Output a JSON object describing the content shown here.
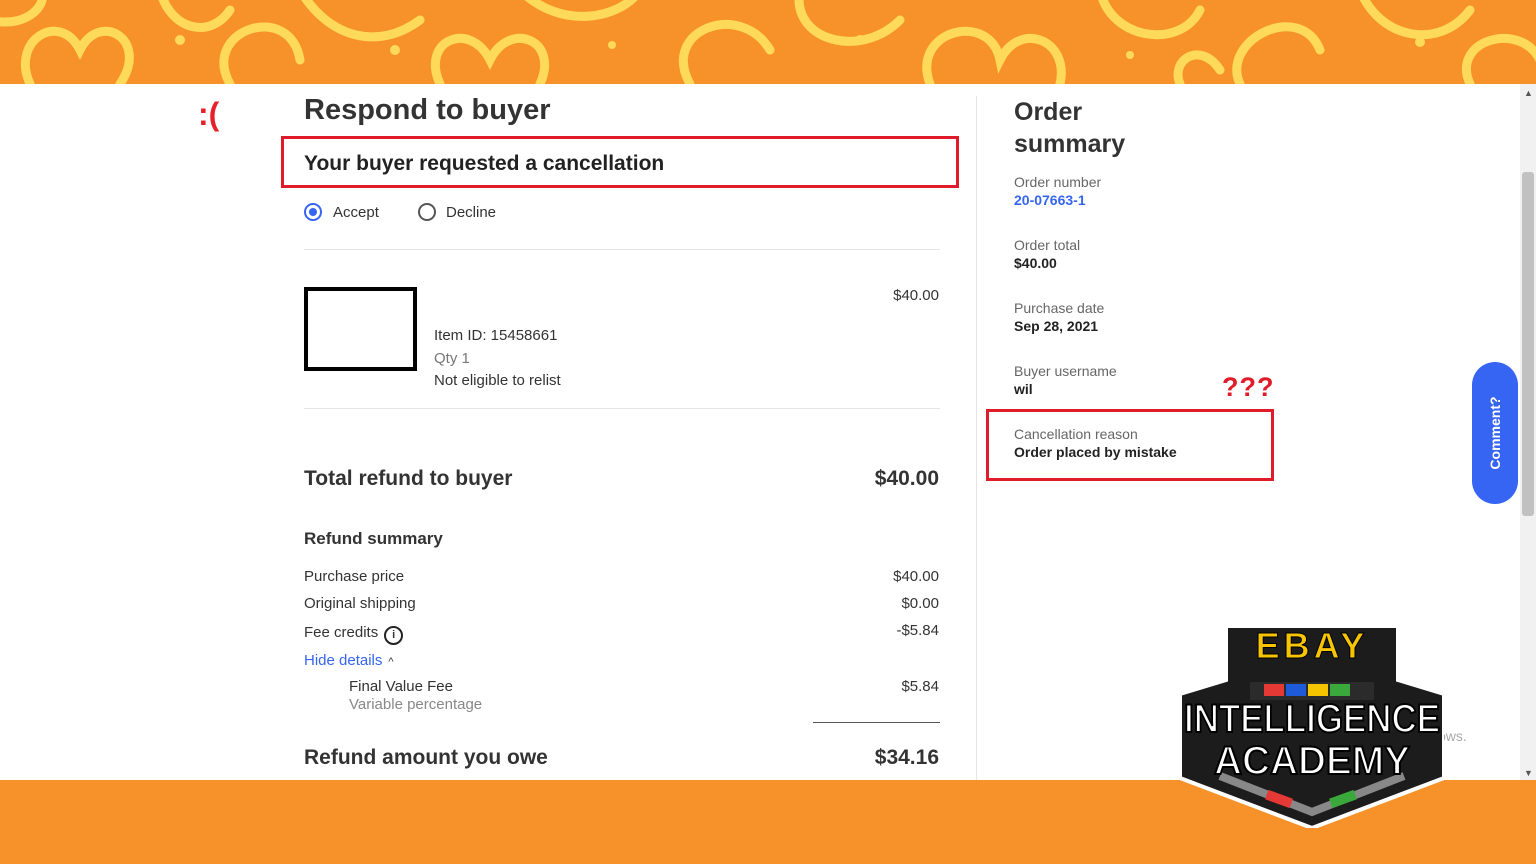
{
  "decoration": {
    "sad_face": ":(",
    "question_marks": "???"
  },
  "header": {
    "title": "Respond to buyer",
    "request": "Your buyer requested a cancellation"
  },
  "response": {
    "accept_label": "Accept",
    "decline_label": "Decline",
    "selected": "Accept"
  },
  "item": {
    "price": "$40.00",
    "item_id": "Item ID: 15458661",
    "qty": "Qty 1",
    "relist": "Not eligible to relist"
  },
  "total": {
    "label": "Total refund to buyer",
    "value": "$40.00"
  },
  "refund_summary": {
    "title": "Refund summary",
    "rows": [
      {
        "label": "Purchase price",
        "value": "$40.00"
      },
      {
        "label": "Original shipping",
        "value": "$0.00"
      },
      {
        "label": "Fee credits",
        "value": "-$5.84"
      }
    ],
    "hide_details": "Hide details",
    "detail": {
      "label": "Final Value Fee",
      "sub": "Variable percentage",
      "value": "$5.84"
    }
  },
  "owe": {
    "label": "Refund amount you owe",
    "value": "$34.16"
  },
  "order_summary": {
    "title": "Order summary",
    "fields": [
      {
        "label": "Order number",
        "value": "20-07663-1"
      },
      {
        "label": "Order total",
        "value": "$40.00"
      },
      {
        "label": "Purchase date",
        "value": "Sep 28, 2021"
      },
      {
        "label": "Buyer username",
        "value": "wil"
      },
      {
        "label": "Cancellation reason",
        "value": "Order placed by mistake"
      }
    ]
  },
  "comment_button": "Comment?",
  "truncated_text": "ows.",
  "logo": {
    "line1": "EBAY",
    "line2": "INTELLIGENCE",
    "line3": "ACADEMY"
  },
  "colors": {
    "accent": "#3665f3",
    "highlight_red": "#e11c2a",
    "banner_orange": "#f7922b",
    "banner_pattern": "#ffd95a"
  }
}
